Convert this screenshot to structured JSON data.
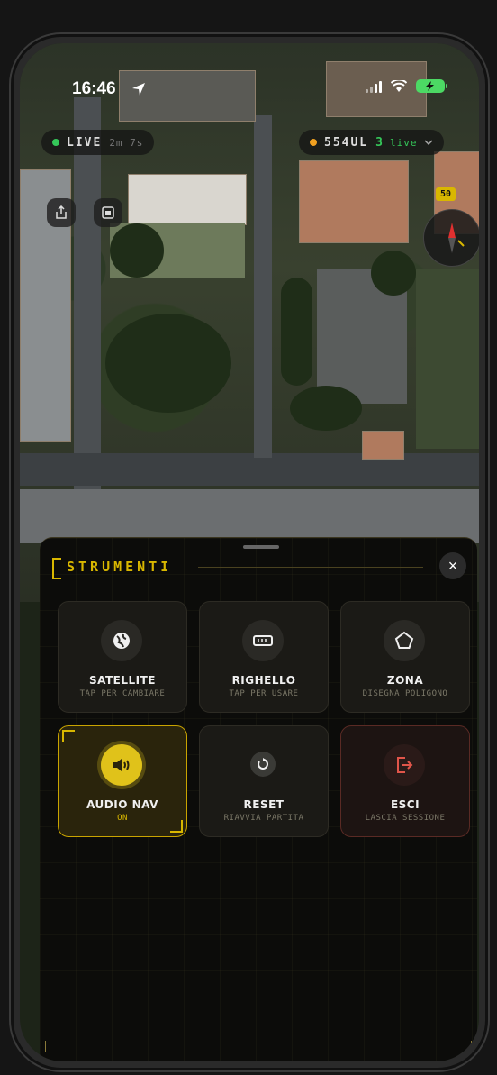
{
  "status_bar": {
    "time": "16:46"
  },
  "top_bar": {
    "live_label": "LIVE",
    "live_sub": "2m 7s",
    "team_code": "554UL",
    "team_count": "3",
    "team_sub": "live"
  },
  "map": {
    "speed_limit": "50"
  },
  "sheet": {
    "title": "STRUMENTI",
    "close_label": "×",
    "tools": [
      {
        "id": "satellite",
        "label": "SATELLITE",
        "sub": "TAP PER CAMBIARE",
        "icon": "globe-icon"
      },
      {
        "id": "ruler",
        "label": "RIGHELLO",
        "sub": "TAP PER USARE",
        "icon": "ruler-icon"
      },
      {
        "id": "zone",
        "label": "ZONA",
        "sub": "DISEGNA POLIGONO",
        "icon": "pentagon-icon"
      },
      {
        "id": "audio",
        "label": "AUDIO NAV",
        "sub": "ON",
        "icon": "speaker-icon"
      },
      {
        "id": "reset",
        "label": "RESET",
        "sub": "RIAVVIA PARTITA",
        "icon": "reset-icon"
      },
      {
        "id": "exit",
        "label": "ESCI",
        "sub": "LASCIA SESSIONE",
        "icon": "exit-icon"
      }
    ]
  },
  "colors": {
    "accent": "#d9b700",
    "danger": "#e0554a",
    "live": "#35c759",
    "team": "#f0a020"
  }
}
